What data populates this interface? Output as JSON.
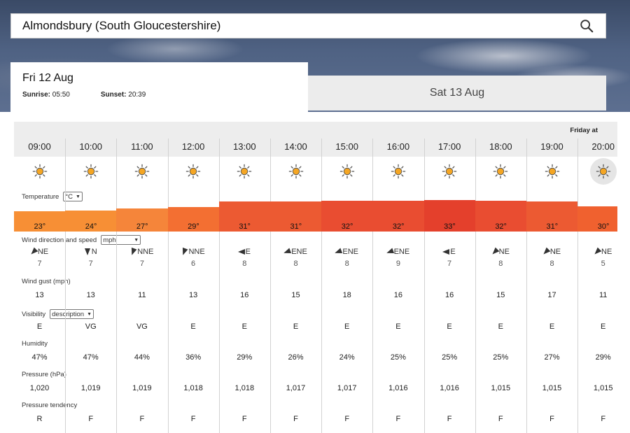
{
  "search": {
    "location": "Almondsbury (South Gloucestershire)"
  },
  "tabs": {
    "active": {
      "title": "Fri 12 Aug",
      "sunrise_label": "Sunrise:",
      "sunrise": "05:50",
      "sunset_label": "Sunset:",
      "sunset": "20:39"
    },
    "inactive": {
      "title": "Sat 13 Aug"
    }
  },
  "table": {
    "friday_at": "Friday at",
    "hours": [
      "09:00",
      "10:00",
      "11:00",
      "12:00",
      "13:00",
      "14:00",
      "15:00",
      "16:00",
      "17:00",
      "18:00",
      "19:00",
      "20:00"
    ],
    "weather_icon": "sunny-icon",
    "labels": {
      "temperature": "Temperature",
      "temperature_unit": "°C",
      "wind": "Wind direction and speed",
      "wind_unit": "mph",
      "gust": "Wind gust (mph)",
      "visibility": "Visibility",
      "visibility_mode": "description",
      "humidity": "Humidity",
      "pressure": "Pressure (hPa)",
      "tendency": "Pressure tendency"
    },
    "temperatures": [
      "23°",
      "24°",
      "27°",
      "29°",
      "31°",
      "31°",
      "32°",
      "32°",
      "33°",
      "32°",
      "31°",
      "30°"
    ],
    "temperature_values": [
      23,
      24,
      27,
      29,
      31,
      31,
      32,
      32,
      33,
      32,
      31,
      30
    ],
    "temperature_colors": [
      "#f78f35",
      "#f78f35",
      "#f5853a",
      "#f36f32",
      "#ec5a32",
      "#ec5a32",
      "#e94d31",
      "#e94d31",
      "#e4402c",
      "#e94d31",
      "#ec5a32",
      "#f0612f"
    ],
    "wind_dirs": [
      "NE",
      "N",
      "NNE",
      "NNE",
      "E",
      "ENE",
      "ENE",
      "ENE",
      "E",
      "NE",
      "NE",
      "NE"
    ],
    "wind_speeds": [
      "7",
      "7",
      "7",
      "6",
      "8",
      "8",
      "8",
      "9",
      "7",
      "8",
      "8",
      "5"
    ],
    "gusts": [
      "13",
      "13",
      "11",
      "13",
      "16",
      "15",
      "18",
      "16",
      "16",
      "15",
      "17",
      "11"
    ],
    "visibility": [
      "E",
      "VG",
      "VG",
      "E",
      "E",
      "E",
      "E",
      "E",
      "E",
      "E",
      "E",
      "E"
    ],
    "humidity": [
      "47%",
      "47%",
      "44%",
      "36%",
      "29%",
      "26%",
      "24%",
      "25%",
      "25%",
      "25%",
      "27%",
      "29%"
    ],
    "pressure": [
      "1,020",
      "1,019",
      "1,019",
      "1,018",
      "1,018",
      "1,017",
      "1,017",
      "1,016",
      "1,016",
      "1,015",
      "1,015",
      "1,015"
    ],
    "tendency": [
      "R",
      "F",
      "F",
      "F",
      "F",
      "F",
      "F",
      "F",
      "F",
      "F",
      "F",
      "F"
    ]
  }
}
